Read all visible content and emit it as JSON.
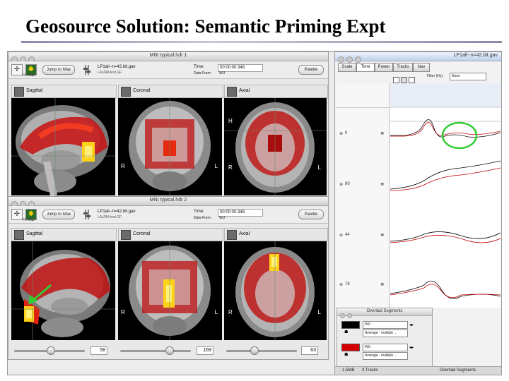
{
  "slide": {
    "title": "Geosource Solution: Semantic Priming Expt"
  },
  "window1": {
    "title": "MNI typical.hdr 1",
    "fit_map_label": "Fit Map",
    "jump_label": "Jump to Max",
    "file": "LP1all--n=42.blt.gav",
    "file2": "LAURA test GF",
    "time_label": "Time:",
    "time_value": "00:00:00.348",
    "data_from_label": "Data From:",
    "data_from_value": "WU",
    "palette_label": "Palette",
    "views": [
      "Sagittal",
      "Coronal",
      "Axial"
    ],
    "coronal_left": "R",
    "coronal_right": "L",
    "axial_h": "H",
    "axial_r": "R",
    "axial_l": "L"
  },
  "window2": {
    "title": "MNI typical.hdr 2",
    "fit_map_label": "Fit Map",
    "jump_label": "Jump to Max",
    "file": "LP1all--n=42.blt.gav",
    "file2": "LAURA test GF",
    "time_label": "Time:",
    "time_value": "00:00:00.348",
    "data_from_label": "Data From:",
    "data_from_value": "WU",
    "palette_label": "Palette",
    "views": [
      "Sagittal",
      "Coronal",
      "Axial"
    ],
    "coronal_left": "R",
    "coronal_right": "L",
    "axial_r": "R",
    "axial_l": "L",
    "slider_values": [
      "58",
      "169",
      "63"
    ]
  },
  "waveform_window": {
    "title": "LP1all--n=42.blt.gav",
    "tabs": [
      "Scale",
      "Time",
      "Power",
      "Tracks",
      "Nav"
    ],
    "filter_label": "Filter (Hz):",
    "filter_value": "None",
    "track_labels": [
      "0",
      "90",
      "44",
      "78"
    ],
    "status_left": "1.5MB",
    "status_mid": "3 Tracks",
    "status_right": "Overlaid Segments"
  },
  "overlaid_segments": {
    "title": "Overlaid Segments",
    "rows": [
      {
        "label": "WU",
        "sub": "Average - multiple ...",
        "color": "#000000"
      },
      {
        "label": "WU",
        "sub": "Average - multiple ...",
        "color": "#d40000"
      }
    ]
  },
  "colors": {
    "activation": "#d01010",
    "highlight": "#ffe000",
    "green_annotation": "#33cc33"
  }
}
